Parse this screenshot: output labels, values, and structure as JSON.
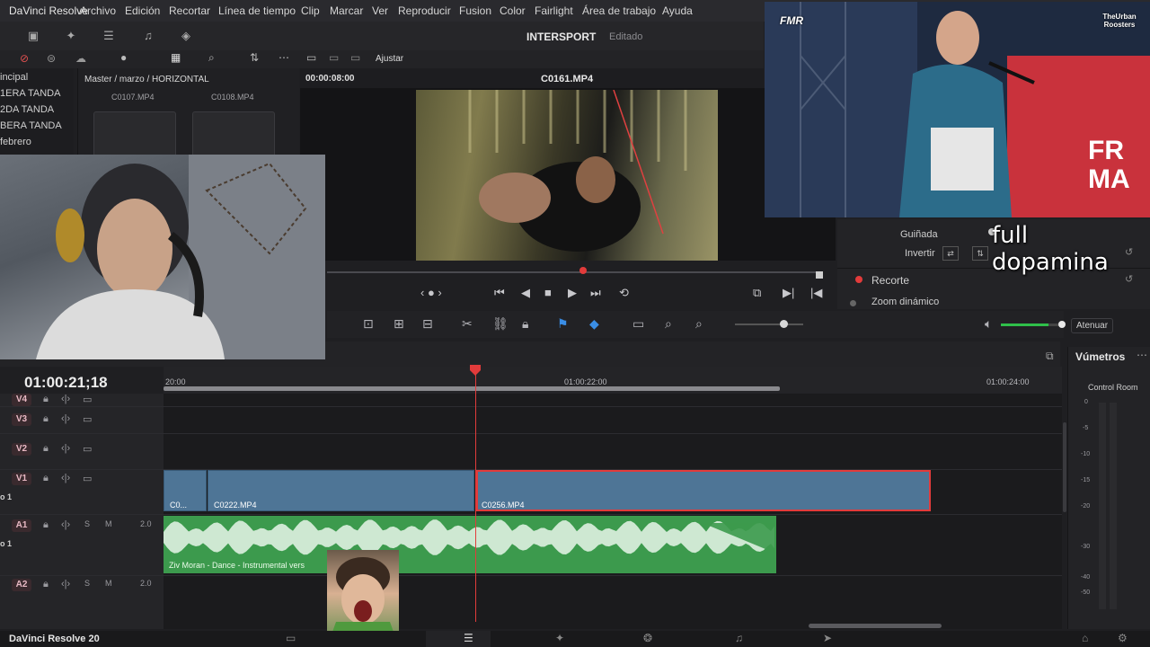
{
  "app": {
    "title": "DaVinci Resolve",
    "version_label": "DaVinci Resolve 20",
    "project_name": "INTERSPORT",
    "project_status": "Editado"
  },
  "menu": [
    "Archivo",
    "Edición",
    "Recortar",
    "Línea de tiempo",
    "Clip",
    "Marcar",
    "Ver",
    "Reproducir",
    "Fusion",
    "Color",
    "Fairlight",
    "Área de trabajo",
    "Ayuda"
  ],
  "media_pool": {
    "bins": [
      "incipal",
      "1ERA TANDA",
      "2DA TANDA",
      "BERA TANDA",
      "febrero"
    ],
    "path": "Master / marzo / HORIZONTAL",
    "clips": [
      "C0107.MP4",
      "C0108.MP4"
    ]
  },
  "viewer": {
    "zoom": "Ajustar",
    "source_timecode": "00:00:08:00",
    "clip_name": "C0161.MP4"
  },
  "inspector": {
    "yaw_label": "Guiñada",
    "invert_label": "Invertir",
    "crop_label": "Recorte",
    "dynamic_zoom_label": "Zoom dinámico"
  },
  "overlay_text": "full dopamina",
  "audio": {
    "mute_label": "Atenuar",
    "meters_title": "Vúmetros",
    "meters_subtitle": "Control Room",
    "db_scale": [
      "0",
      "-5",
      "-10",
      "-15",
      "-20",
      "-30",
      "-40",
      "-50"
    ],
    "volume_level": 0.75
  },
  "timeline": {
    "timecode": "01:00:21;18",
    "ruler": [
      "20:00",
      "01:00:22:00",
      "01:00:24:00"
    ],
    "tracks": [
      {
        "label": "V4"
      },
      {
        "label": "V3"
      },
      {
        "label": "V2"
      },
      {
        "label": "V1"
      },
      {
        "label": "A1",
        "level": "2.0"
      },
      {
        "label": "A2",
        "level": "2.0"
      }
    ],
    "track_side_labels": [
      "o 1",
      "o 1"
    ],
    "clips": [
      "C0...",
      "C0222.MP4",
      "C0256.MP4"
    ],
    "audio_clip": "Ziv Moran - Dance - Instrumental vers",
    "solo": "S",
    "mute": "M"
  },
  "video2_overlays": {
    "logo_left": "FMR",
    "logo_right": "TheUrban Roosters",
    "banner_text": "FR MA"
  },
  "colors": {
    "accent": "#e23b3b",
    "video_clip": "#4e7596",
    "audio_clip": "#3c9a4d",
    "meter_green": "#2fbf4a"
  }
}
